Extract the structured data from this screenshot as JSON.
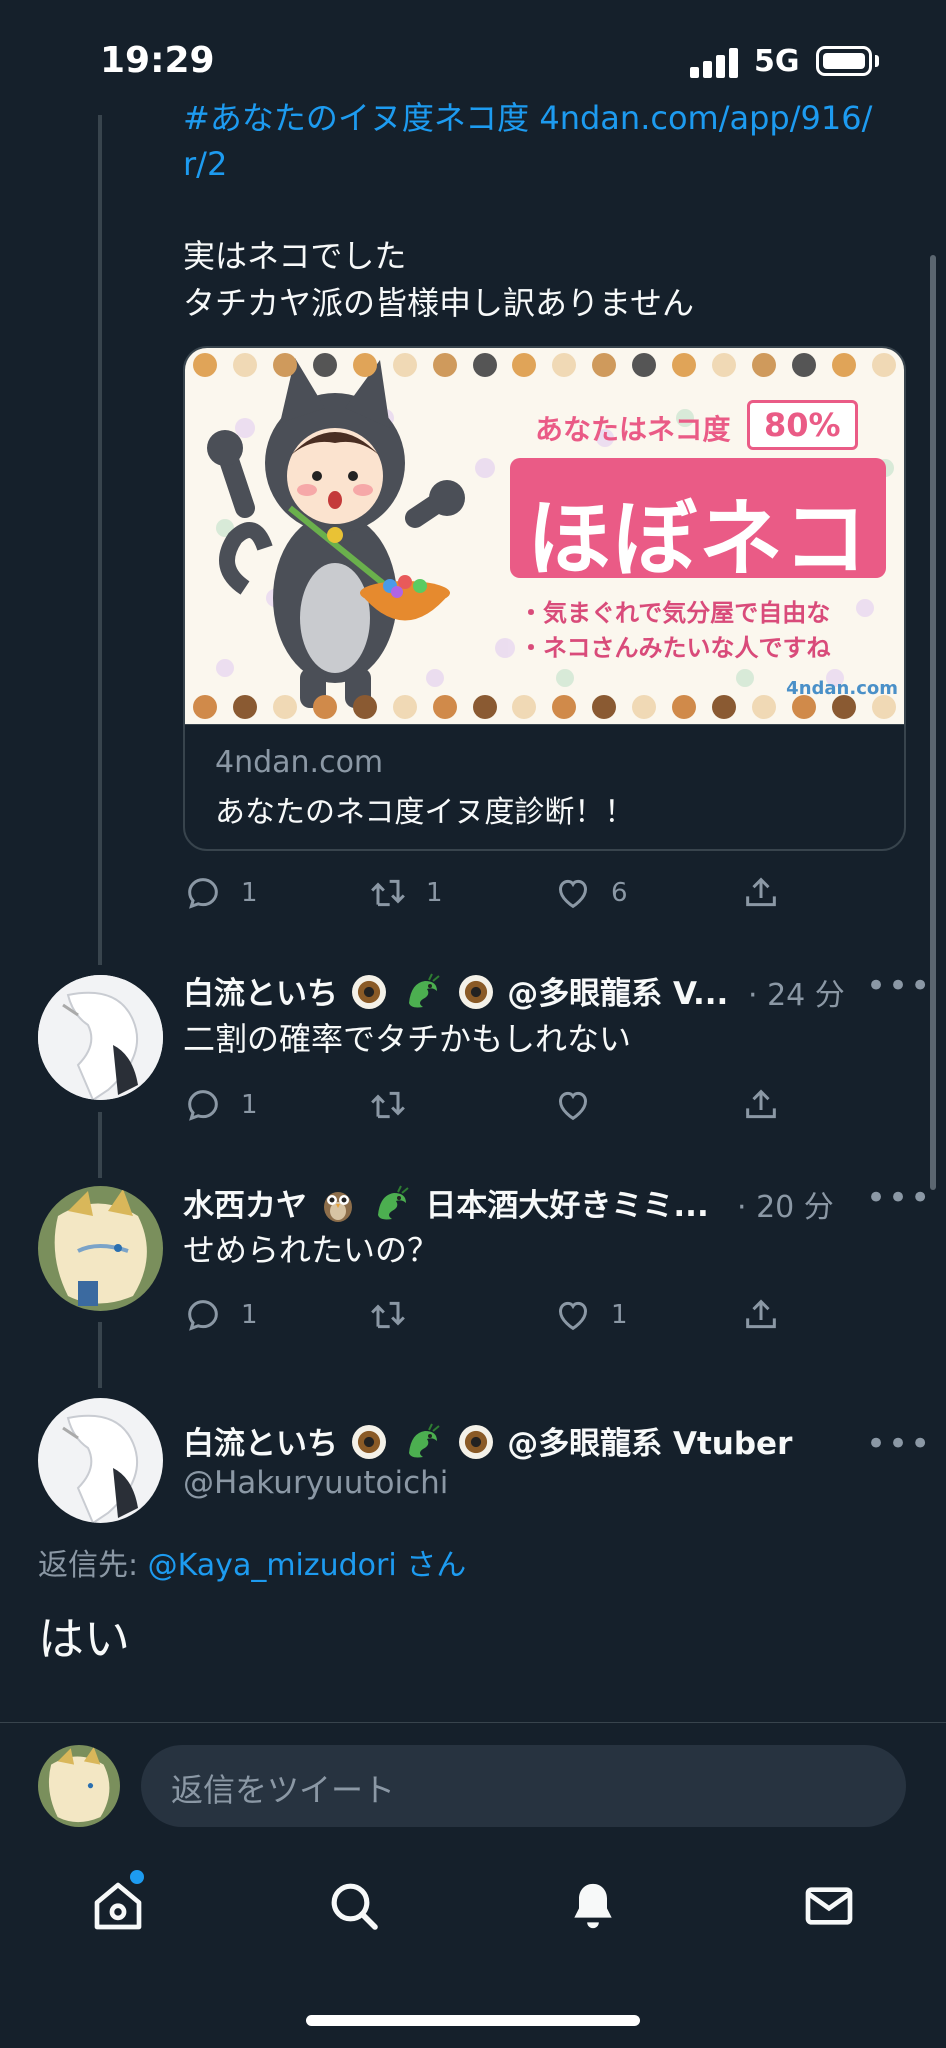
{
  "status_bar": {
    "time": "19:29",
    "network": "5G"
  },
  "main_tweet": {
    "hashtag_line": "#あなたのイヌ度ネコ度 4ndan.com/app/916/",
    "link_cont": "r/2",
    "text_line_1": "実はネコでした",
    "text_line_2": "タチカヤ派の皆様申し訳ありません",
    "card": {
      "result_label": "あなたはネコ度",
      "result_percent": "80%",
      "result_title": "ほぼネコ",
      "line_1": "・気まぐれで気分屋で自由な",
      "line_2": "・ネコさんみたいな人ですね",
      "watermark": "4ndan.com",
      "domain": "4ndan.com",
      "title": "あなたのネコ度イヌ度診断！！"
    },
    "actions": {
      "replies": "1",
      "retweets": "1",
      "likes": "6"
    }
  },
  "reply_1": {
    "name": "白流といち",
    "name_suffix": "@多眼龍系 V...",
    "time": "· 24 分",
    "text": "二割の確率でタチかもしれない",
    "actions": {
      "replies": "1",
      "retweets": "",
      "likes": ""
    }
  },
  "reply_2": {
    "name": "水西カヤ",
    "name_suffix": "日本酒大好きミミ...",
    "time": "· 20 分",
    "text": "せめられたいの？",
    "actions": {
      "replies": "1",
      "retweets": "",
      "likes": "1"
    }
  },
  "focused_tweet": {
    "name": "白流といち",
    "name_suffix": "@多眼龍系 Vtuber",
    "handle": "@Hakuryuutoichi",
    "reply_to_label": "返信先:",
    "reply_to_handle": "@Kaya_mizudori",
    "reply_to_suffix": "さん",
    "text": "はい"
  },
  "compose": {
    "placeholder": "返信をツイート"
  },
  "colors": {
    "background": "#15202b",
    "accent": "#1d9bf0",
    "muted": "#8b98a5",
    "divider": "#38444d"
  }
}
